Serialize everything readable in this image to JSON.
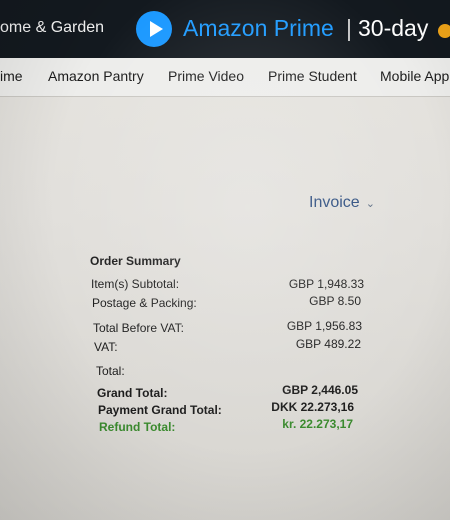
{
  "header": {
    "category_link": "ome & Garden",
    "prime_brand": "Amazon Prime",
    "separator": "|",
    "trial_text": "30-day",
    "colors": {
      "bar": "#13191f",
      "prime_blue": "#1e9bff",
      "accent": "#f0a519"
    }
  },
  "nav": {
    "items": [
      {
        "label": "ime"
      },
      {
        "label": "Amazon Pantry"
      },
      {
        "label": "Prime Video"
      },
      {
        "label": "Prime Student"
      },
      {
        "label": "Mobile App"
      }
    ]
  },
  "invoice": {
    "label": "Invoice",
    "chevron": "⌄"
  },
  "order_summary": {
    "heading": "Order Summary",
    "rows": {
      "subtotal": {
        "label": "Item(s) Subtotal:",
        "value": "GBP 1,948.33"
      },
      "postage": {
        "label": "Postage & Packing:",
        "value": "GBP 8.50"
      },
      "before_vat": {
        "label": "Total Before VAT:",
        "value": "GBP 1,956.83"
      },
      "vat": {
        "label": "VAT:",
        "value": "GBP 489.22"
      },
      "total": {
        "label": "Total:",
        "value": ""
      },
      "grand_total": {
        "label": "Grand Total:",
        "value": "GBP 2,446.05"
      },
      "payment_grand_total": {
        "label": "Payment Grand Total:",
        "value": "DKK 22.273,16"
      },
      "refund_total": {
        "label": "Refund Total:",
        "value": "kr. 22.273,17"
      }
    },
    "colors": {
      "refund": "#3a8a2e",
      "link": "#2b4c7e"
    }
  }
}
